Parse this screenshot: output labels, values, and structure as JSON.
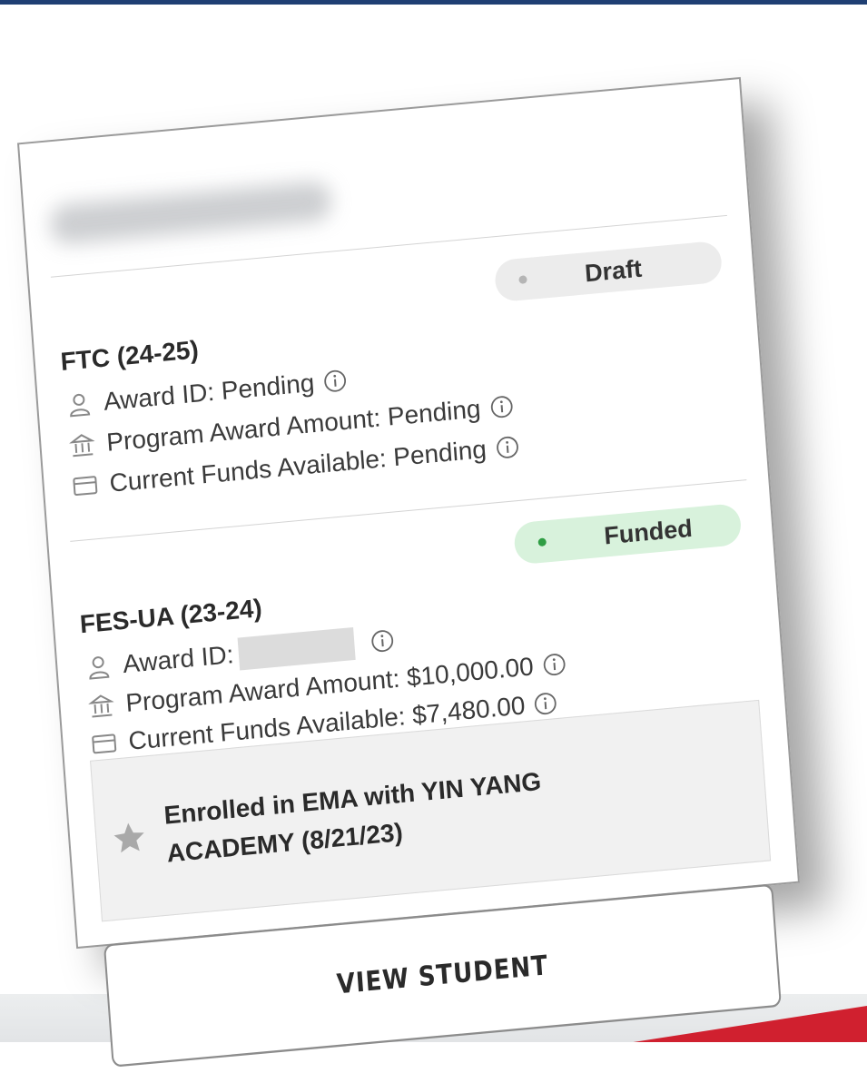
{
  "programs": [
    {
      "title": "FTC (24-25)",
      "status": "Draft",
      "award_id_label": "Award ID:",
      "award_id_value": "Pending",
      "program_award_amount": "Program Award Amount: Pending",
      "current_funds_available": "Current Funds Available: Pending"
    },
    {
      "title": "FES-UA (23-24)",
      "status": "Funded",
      "award_id_label": "Award ID:",
      "program_award_amount": "Program Award Amount: $10,000.00",
      "current_funds_available": "Current Funds Available: $7,480.00",
      "enrollment_note": "Enrolled in EMA with YIN YANG ACADEMY (8/21/23)",
      "button_label": "VIEW STUDENT"
    }
  ],
  "icons": {
    "person": "person-icon",
    "bank": "bank-icon",
    "card": "credit-card-icon",
    "info": "info-icon",
    "star": "star-icon"
  },
  "colors": {
    "draft_badge_bg": "#ececec",
    "draft_dot": "#b5b5b5",
    "funded_badge_bg": "#d8f2dc",
    "funded_dot": "#2f9e44",
    "top_bar": "#1f3f73",
    "accent_red": "#d0202f"
  }
}
